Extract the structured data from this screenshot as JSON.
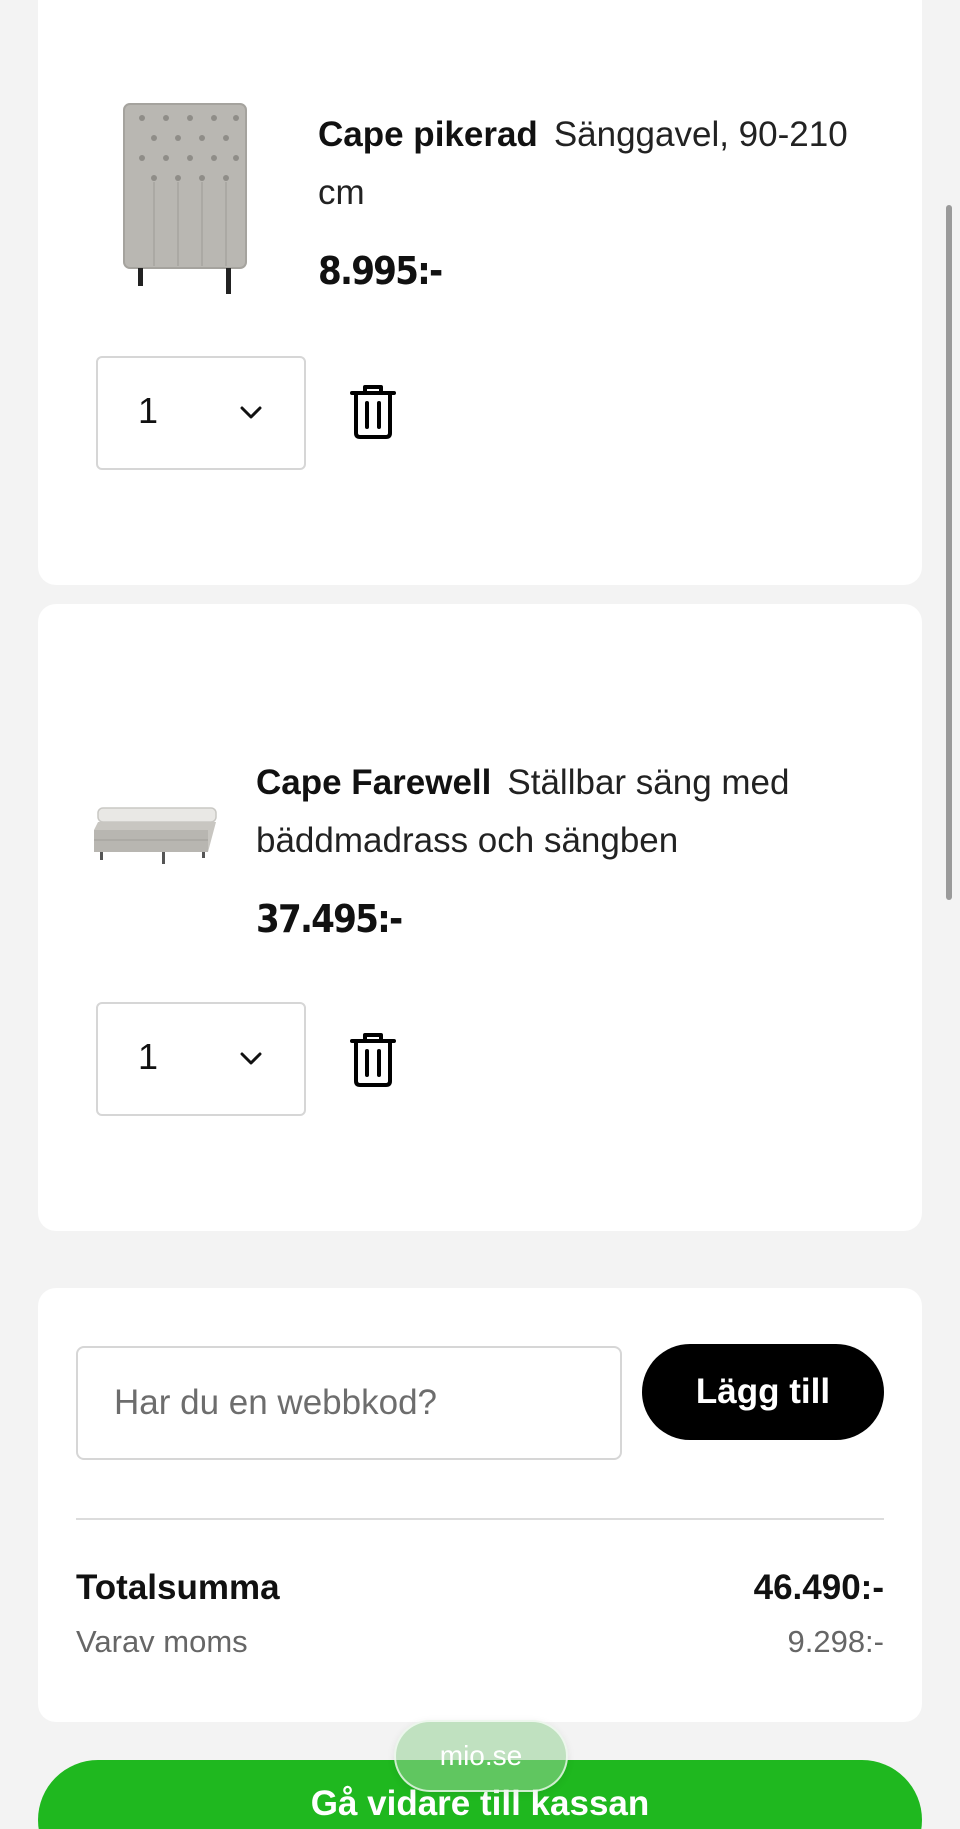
{
  "cart": {
    "items": [
      {
        "name": "Cape pikerad",
        "description": "Sänggavel, 90-210 cm",
        "price": "8.995:-",
        "quantity": "1",
        "image_icon": "headboard-image"
      },
      {
        "name": "Cape Farewell",
        "description": "Ställbar säng med bäddmadrass och sängben",
        "price": "37.495:-",
        "quantity": "1",
        "image_icon": "adjustable-bed-image"
      }
    ]
  },
  "summary": {
    "code_placeholder": "Har du en webbkod?",
    "add_label": "Lägg till",
    "total_label": "Totalsumma",
    "total_value": "46.490:-",
    "moms_label": "Varav moms",
    "moms_value": "9.298:-"
  },
  "checkout": {
    "label": "Gå vidare till kassan",
    "color": "#1fb81f"
  },
  "browser": {
    "url": "mio.se"
  }
}
